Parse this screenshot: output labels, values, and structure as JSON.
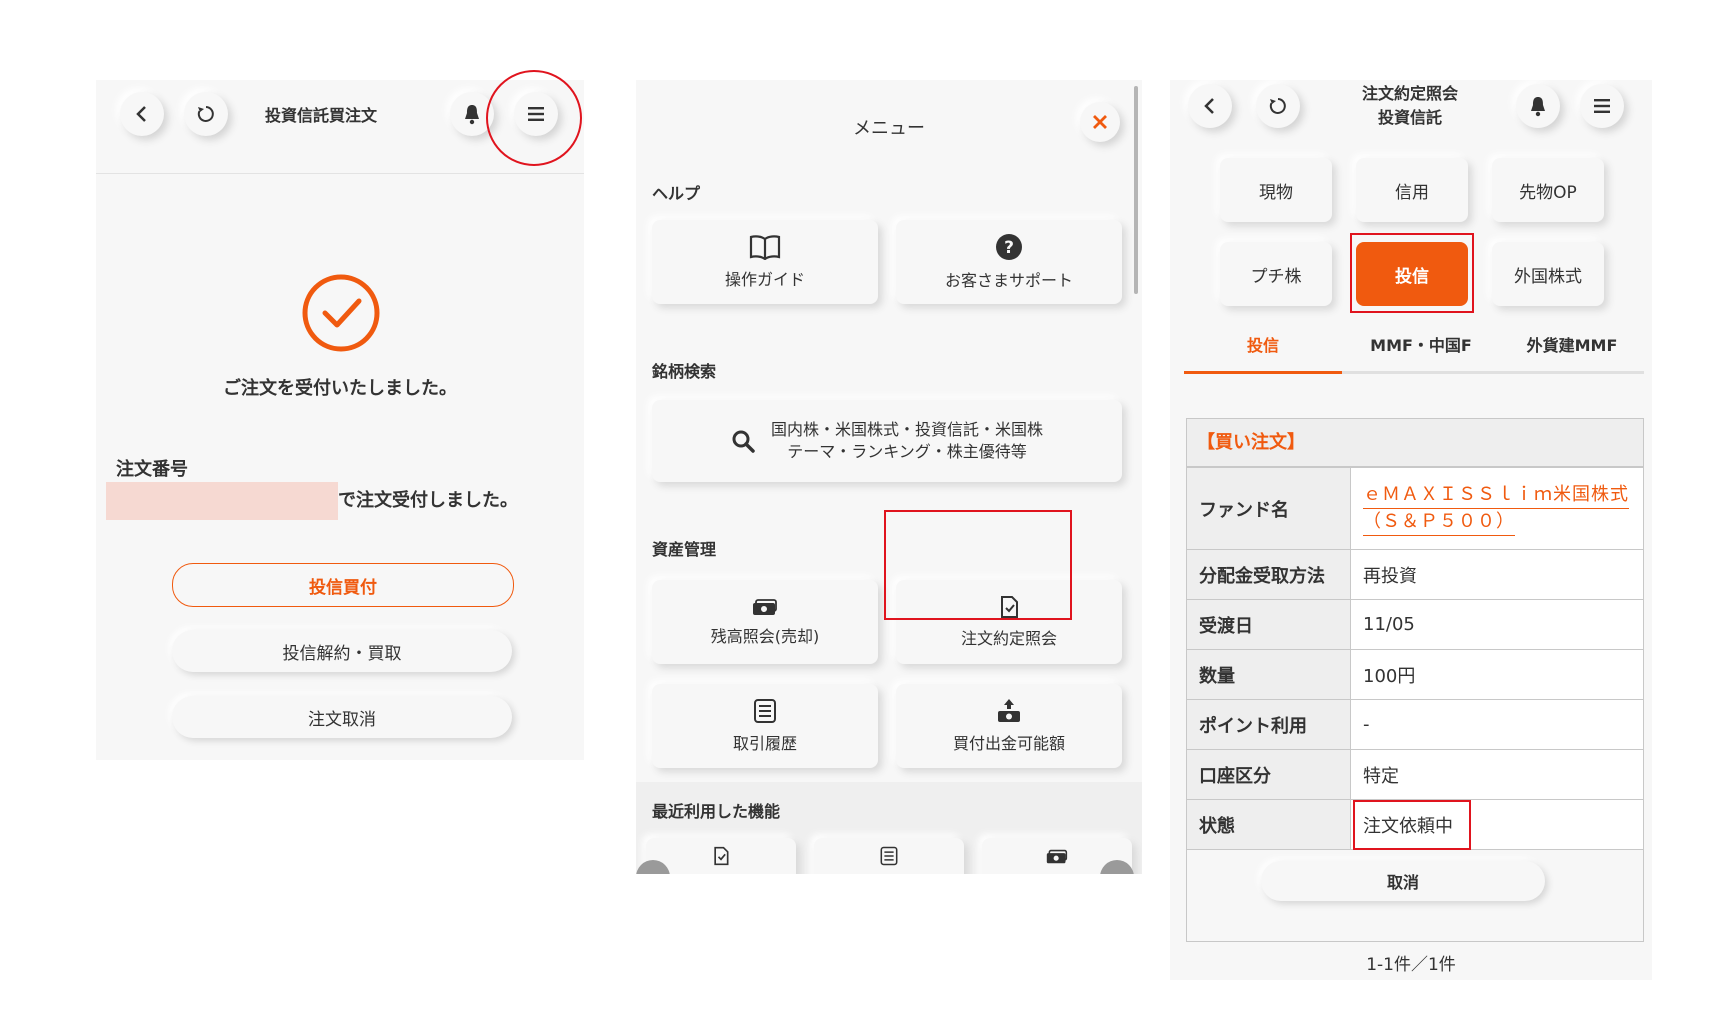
{
  "left": {
    "title": "投資信託買注文",
    "success_message": "ご注文を受付いたしました。",
    "order_label": "注文番号",
    "order_suffix": "で注文受付しました。",
    "buttons": {
      "buy": "投信買付",
      "sell": "投信解約・買取",
      "cancel": "注文取消"
    }
  },
  "menu": {
    "title": "メニュー",
    "help_title": "ヘルプ",
    "guide": "操作ガイド",
    "support": "お客さまサポート",
    "search_title": "銘柄検索",
    "search_line1": "国内株・米国株式・投資信託・米国株",
    "search_line2": "テーマ・ランキング・株主優待等",
    "assets_title": "資産管理",
    "balance": "残高照会(売却)",
    "order_inquiry": "注文約定照会",
    "history": "取引履歴",
    "buying_power": "買付出金可能額",
    "recent_title": "最近利用した機能"
  },
  "right": {
    "title_line1": "注文約定照会",
    "title_line2": "投資信託",
    "categories": [
      "現物",
      "信用",
      "先物OP",
      "プチ株",
      "投信",
      "外国株式"
    ],
    "tabs": [
      "投信",
      "MMF・中国F",
      "外貨建MMF"
    ],
    "section_header": "【買い注文】",
    "fund_label": "ファンド名",
    "fund_line1": "ｅＭＡＸＩＳＳｌｉｍ米国株式",
    "fund_line2": "（Ｓ＆Ｐ５００）",
    "rows": [
      {
        "key": "分配金受取方法",
        "value": "再投資"
      },
      {
        "key": "受渡日",
        "value": "11/05"
      },
      {
        "key": "数量",
        "value": "100円"
      },
      {
        "key": "ポイント利用",
        "value": "-"
      },
      {
        "key": "口座区分",
        "value": "特定"
      },
      {
        "key": "状態",
        "value": "注文依頼中"
      }
    ],
    "cancel_button": "取消",
    "count": "1-1件／1件"
  },
  "colors": {
    "accent": "#f05a0f",
    "highlight": "#e0141e",
    "panel": "#f7f7f7"
  }
}
